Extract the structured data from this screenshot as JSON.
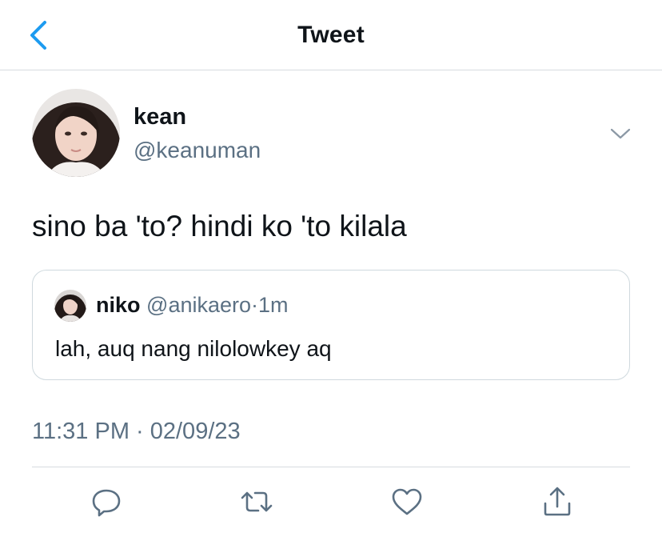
{
  "header": {
    "title": "Tweet",
    "back_icon": "chevron-left-icon",
    "accent_color": "#1d9bf0"
  },
  "tweet": {
    "author": {
      "name": "kean",
      "handle": "@keanuman"
    },
    "text": "sino ba 'to? hindi ko 'to kilala",
    "more_icon": "chevron-down-icon",
    "quoted": {
      "name": "niko",
      "handle": "@anikaero",
      "separator": "·",
      "time": "1m",
      "text": "lah, auq nang nilolowkey aq"
    },
    "timestamp": "11:31 PM · 02/09/23"
  },
  "actions": [
    "reply-icon",
    "retweet-icon",
    "like-icon",
    "share-icon"
  ]
}
